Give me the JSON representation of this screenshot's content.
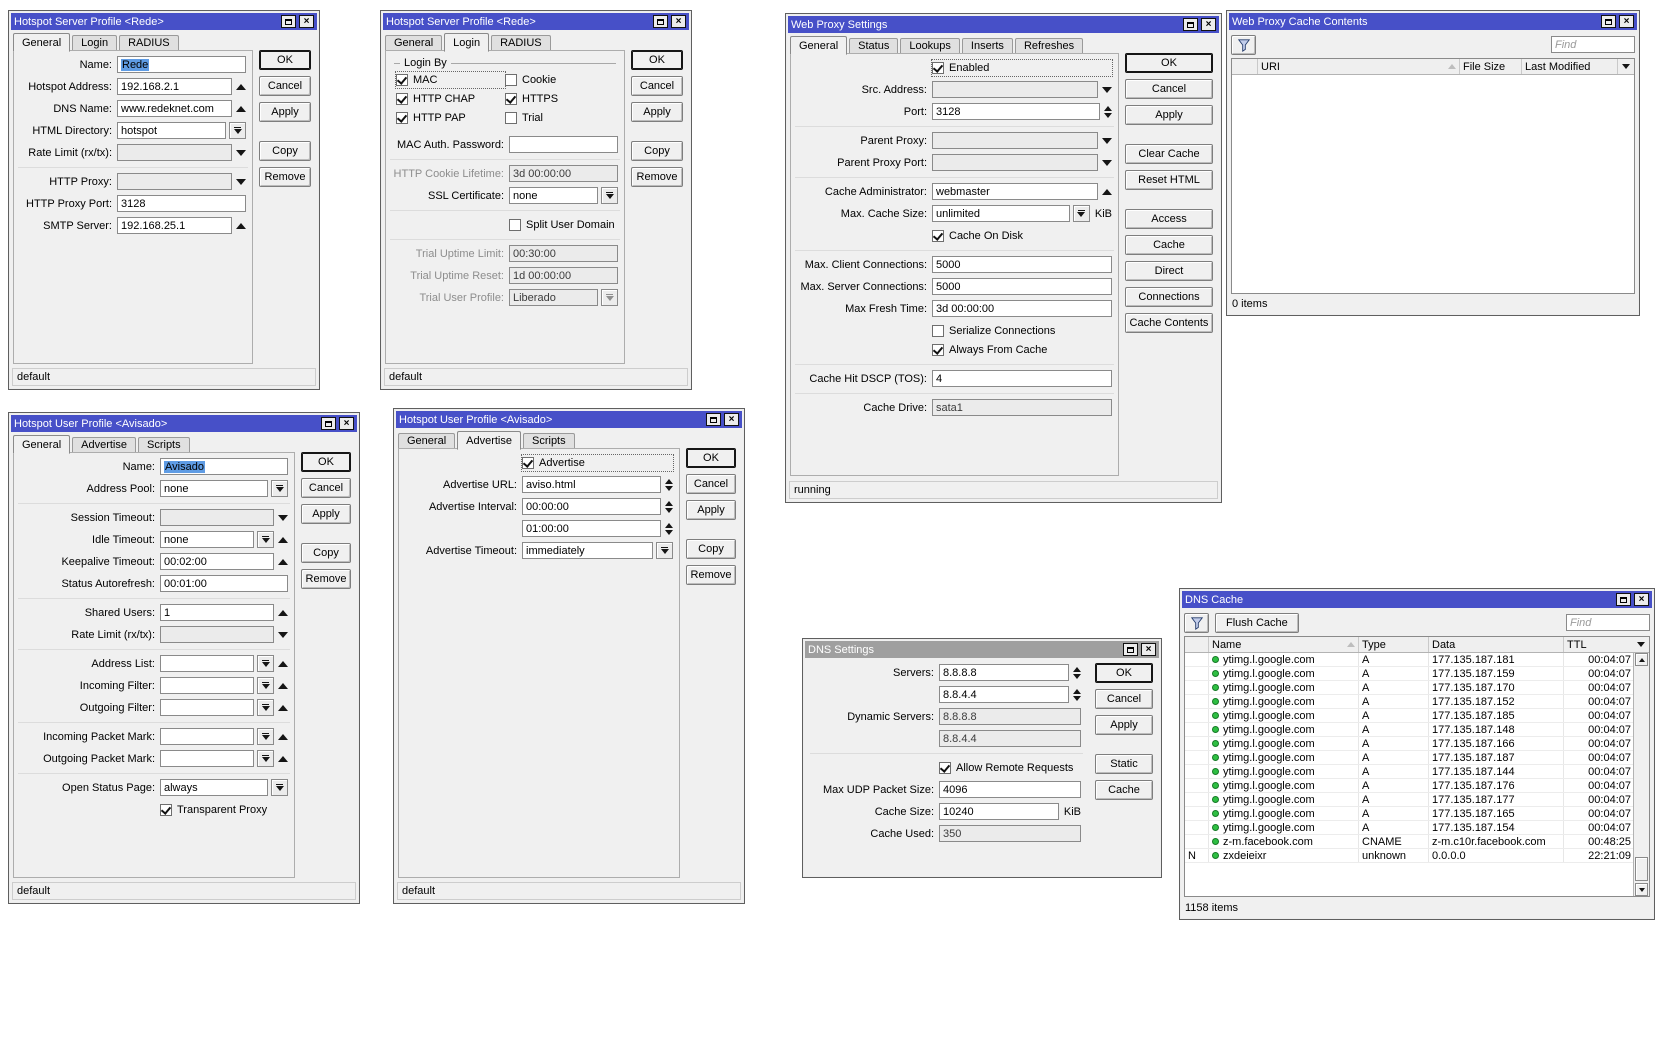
{
  "colors": {
    "titlebar_active": "#4750c8",
    "titlebar_inactive": "#9f9f9f",
    "selection": "#5f9ce4",
    "status_dot_green": "#2fbf43",
    "dialog_bg": "#f0f0f0"
  },
  "icons": {
    "filter": "funnel-icon",
    "sort": "sort-ascending-icon",
    "maximize": "maximize-icon",
    "close": "close-icon"
  },
  "server_profile_general": {
    "title": "Hotspot Server Profile <Rede>",
    "tabs": [
      "General",
      "Login",
      "RADIUS"
    ],
    "name_label": "Name:",
    "name_value": "Rede",
    "hotspot_address_label": "Hotspot Address:",
    "hotspot_address_value": "192.168.2.1",
    "dns_name_label": "DNS Name:",
    "dns_name_value": "www.redeknet.com",
    "html_directory_label": "HTML Directory:",
    "html_directory_value": "hotspot",
    "rate_limit_label": "Rate Limit (rx/tx):",
    "http_proxy_label": "HTTP Proxy:",
    "http_proxy_port_label": "HTTP Proxy Port:",
    "http_proxy_port_value": "3128",
    "smtp_server_label": "SMTP Server:",
    "smtp_server_value": "192.168.25.1",
    "ok": "OK",
    "cancel": "Cancel",
    "apply": "Apply",
    "copy": "Copy",
    "remove": "Remove",
    "status": "default"
  },
  "server_profile_login": {
    "title": "Hotspot Server Profile <Rede>",
    "tabs": [
      "General",
      "Login",
      "RADIUS"
    ],
    "login_by": "Login By",
    "mac": "MAC",
    "cookie": "Cookie",
    "http_chap": "HTTP CHAP",
    "https": "HTTPS",
    "http_pap": "HTTP PAP",
    "trial": "Trial",
    "mac_auth_password_label": "MAC Auth. Password:",
    "http_cookie_lifetime_label": "HTTP Cookie Lifetime:",
    "http_cookie_lifetime_value": "3d 00:00:00",
    "ssl_certificate_label": "SSL Certificate:",
    "ssl_certificate_value": "none",
    "split_user_domain": "Split User Domain",
    "trial_uptime_limit_label": "Trial Uptime Limit:",
    "trial_uptime_limit_value": "00:30:00",
    "trial_uptime_reset_label": "Trial Uptime Reset:",
    "trial_uptime_reset_value": "1d 00:00:00",
    "trial_user_profile_label": "Trial User Profile:",
    "trial_user_profile_value": "Liberado",
    "ok": "OK",
    "cancel": "Cancel",
    "apply": "Apply",
    "copy": "Copy",
    "remove": "Remove",
    "status": "default"
  },
  "web_proxy": {
    "title": "Web Proxy Settings",
    "tabs": [
      "General",
      "Status",
      "Lookups",
      "Inserts",
      "Refreshes"
    ],
    "enabled": "Enabled",
    "src_address_label": "Src. Address:",
    "port_label": "Port:",
    "port_value": "3128",
    "parent_proxy_label": "Parent Proxy:",
    "parent_proxy_port_label": "Parent Proxy Port:",
    "cache_administrator_label": "Cache Administrator:",
    "cache_administrator_value": "webmaster",
    "max_cache_size_label": "Max. Cache Size:",
    "max_cache_size_value": "unlimited",
    "kib": "KiB",
    "cache_on_disk": "Cache On Disk",
    "max_client_connections_label": "Max. Client Connections:",
    "max_client_connections_value": "5000",
    "max_server_connections_label": "Max. Server Connections:",
    "max_server_connections_value": "5000",
    "max_fresh_time_label": "Max Fresh Time:",
    "max_fresh_time_value": "3d 00:00:00",
    "serialize_connections": "Serialize Connections",
    "always_from_cache": "Always From Cache",
    "cache_hit_dscp_label": "Cache Hit DSCP (TOS):",
    "cache_hit_dscp_value": "4",
    "cache_drive_label": "Cache Drive:",
    "cache_drive_value": "sata1",
    "ok": "OK",
    "cancel": "Cancel",
    "apply": "Apply",
    "clear_cache": "Clear Cache",
    "reset_html": "Reset HTML",
    "access": "Access",
    "cache": "Cache",
    "direct": "Direct",
    "connections": "Connections",
    "cache_contents": "Cache Contents",
    "status": "running"
  },
  "proxy_cache": {
    "title": "Web Proxy Cache Contents",
    "find_placeholder": "Find",
    "col_uri": "URI",
    "col_file_size": "File Size",
    "col_last_modified": "Last Modified",
    "items": "0 items"
  },
  "user_profile_general": {
    "title": "Hotspot User Profile <Avisado>",
    "tabs": [
      "General",
      "Advertise",
      "Scripts"
    ],
    "name_label": "Name:",
    "name_value": "Avisado",
    "address_pool_label": "Address Pool:",
    "address_pool_value": "none",
    "session_timeout_label": "Session Timeout:",
    "idle_timeout_label": "Idle Timeout:",
    "idle_timeout_value": "none",
    "keepalive_timeout_label": "Keepalive Timeout:",
    "keepalive_timeout_value": "00:02:00",
    "status_autorefresh_label": "Status Autorefresh:",
    "status_autorefresh_value": "00:01:00",
    "shared_users_label": "Shared Users:",
    "shared_users_value": "1",
    "rate_limit_label": "Rate Limit (rx/tx):",
    "address_list_label": "Address List:",
    "incoming_filter_label": "Incoming Filter:",
    "outgoing_filter_label": "Outgoing Filter:",
    "incoming_packet_mark_label": "Incoming Packet Mark:",
    "outgoing_packet_mark_label": "Outgoing Packet Mark:",
    "open_status_page_label": "Open Status Page:",
    "open_status_page_value": "always",
    "transparent_proxy": "Transparent Proxy",
    "ok": "OK",
    "cancel": "Cancel",
    "apply": "Apply",
    "copy": "Copy",
    "remove": "Remove",
    "status": "default"
  },
  "user_profile_advertise": {
    "title": "Hotspot User Profile <Avisado>",
    "tabs": [
      "General",
      "Advertise",
      "Scripts"
    ],
    "advertise": "Advertise",
    "advertise_url_label": "Advertise URL:",
    "advertise_url_value": "aviso.html",
    "advertise_interval_label": "Advertise Interval:",
    "advertise_interval_value": "00:00:00",
    "advertise_interval_value2": "01:00:00",
    "advertise_timeout_label": "Advertise Timeout:",
    "advertise_timeout_value": "immediately",
    "ok": "OK",
    "cancel": "Cancel",
    "apply": "Apply",
    "copy": "Copy",
    "remove": "Remove",
    "status": "default"
  },
  "dns_settings": {
    "title": "DNS Settings",
    "servers_label": "Servers:",
    "servers_value_1": "8.8.8.8",
    "servers_value_2": "8.8.4.4",
    "dynamic_servers_label": "Dynamic Servers:",
    "dynamic_servers_value_1": "8.8.8.8",
    "dynamic_servers_value_2": "8.8.4.4",
    "allow_remote_requests": "Allow Remote Requests",
    "max_udp_packet_size_label": "Max UDP Packet Size:",
    "max_udp_packet_size_value": "4096",
    "cache_size_label": "Cache Size:",
    "cache_size_value": "10240",
    "kib": "KiB",
    "cache_used_label": "Cache Used:",
    "cache_used_value": "350",
    "ok": "OK",
    "cancel": "Cancel",
    "apply": "Apply",
    "static": "Static",
    "cache": "Cache"
  },
  "dns_cache": {
    "title": "DNS Cache",
    "flush_cache": "Flush Cache",
    "find_placeholder": "Find",
    "col_name": "Name",
    "col_type": "Type",
    "col_data": "Data",
    "col_ttl": "TTL",
    "rows": [
      {
        "flag": "",
        "name": "ytimg.l.google.com",
        "type": "A",
        "data": "177.135.187.181",
        "ttl": "00:04:07"
      },
      {
        "flag": "",
        "name": "ytimg.l.google.com",
        "type": "A",
        "data": "177.135.187.159",
        "ttl": "00:04:07"
      },
      {
        "flag": "",
        "name": "ytimg.l.google.com",
        "type": "A",
        "data": "177.135.187.170",
        "ttl": "00:04:07"
      },
      {
        "flag": "",
        "name": "ytimg.l.google.com",
        "type": "A",
        "data": "177.135.187.152",
        "ttl": "00:04:07"
      },
      {
        "flag": "",
        "name": "ytimg.l.google.com",
        "type": "A",
        "data": "177.135.187.185",
        "ttl": "00:04:07"
      },
      {
        "flag": "",
        "name": "ytimg.l.google.com",
        "type": "A",
        "data": "177.135.187.148",
        "ttl": "00:04:07"
      },
      {
        "flag": "",
        "name": "ytimg.l.google.com",
        "type": "A",
        "data": "177.135.187.166",
        "ttl": "00:04:07"
      },
      {
        "flag": "",
        "name": "ytimg.l.google.com",
        "type": "A",
        "data": "177.135.187.187",
        "ttl": "00:04:07"
      },
      {
        "flag": "",
        "name": "ytimg.l.google.com",
        "type": "A",
        "data": "177.135.187.144",
        "ttl": "00:04:07"
      },
      {
        "flag": "",
        "name": "ytimg.l.google.com",
        "type": "A",
        "data": "177.135.187.176",
        "ttl": "00:04:07"
      },
      {
        "flag": "",
        "name": "ytimg.l.google.com",
        "type": "A",
        "data": "177.135.187.177",
        "ttl": "00:04:07"
      },
      {
        "flag": "",
        "name": "ytimg.l.google.com",
        "type": "A",
        "data": "177.135.187.165",
        "ttl": "00:04:07"
      },
      {
        "flag": "",
        "name": "ytimg.l.google.com",
        "type": "A",
        "data": "177.135.187.154",
        "ttl": "00:04:07"
      },
      {
        "flag": "",
        "name": "z-m.facebook.com",
        "type": "CNAME",
        "data": "z-m.c10r.facebook.com",
        "ttl": "00:48:25"
      },
      {
        "flag": "N",
        "name": "zxdeieixr",
        "type": "unknown",
        "data": "0.0.0.0",
        "ttl": "22:21:09"
      }
    ],
    "items": "1158 items"
  }
}
